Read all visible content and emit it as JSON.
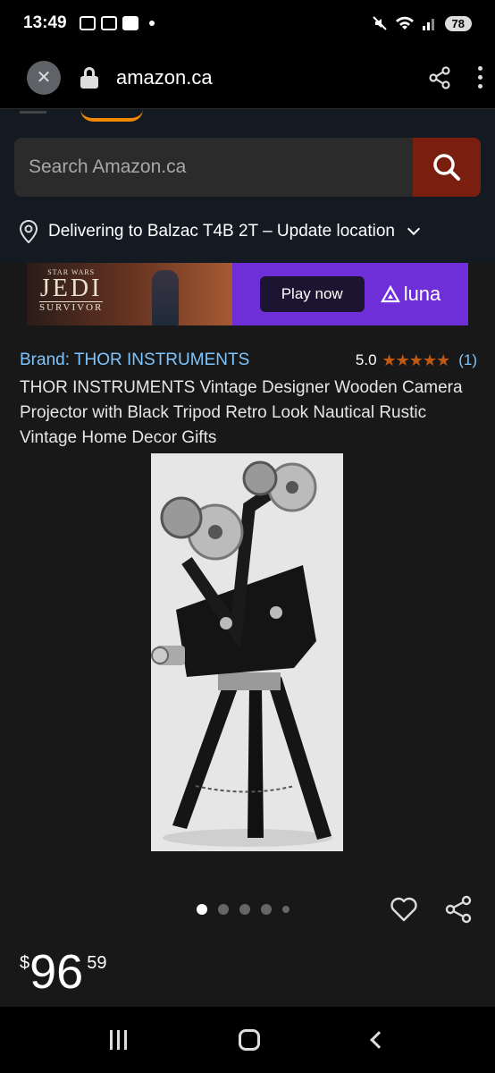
{
  "status_bar": {
    "time": "13:49",
    "battery": "78"
  },
  "browser": {
    "url": "amazon.ca"
  },
  "search": {
    "placeholder": "Search Amazon.ca"
  },
  "delivery": {
    "text": "Delivering to Balzac T4B 2T – Update location"
  },
  "ad": {
    "franchise": "STAR WARS",
    "game_title": "JEDI",
    "game_subtitle": "SURVIVOR",
    "cta": "Play now",
    "brand": "luna",
    "accent_color": "#6f2fd8"
  },
  "product": {
    "brand_label": "Brand: THOR INSTRUMENTS",
    "rating": "5.0",
    "stars": "★★★★★",
    "review_count": "(1)",
    "title": "THOR INSTRUMENTS Vintage Designer Wooden Camera Projector with Black Tripod Retro Look Nautical Rustic Vintage Home Decor Gifts",
    "image_icon": "projector-image",
    "carousel_count": 5,
    "carousel_active_index": 0,
    "price": {
      "currency": "$",
      "whole": "96",
      "fraction": "59"
    }
  },
  "colors": {
    "link": "#7ec5ff",
    "star": "#c05a12",
    "search_button": "#7a1f0f"
  }
}
